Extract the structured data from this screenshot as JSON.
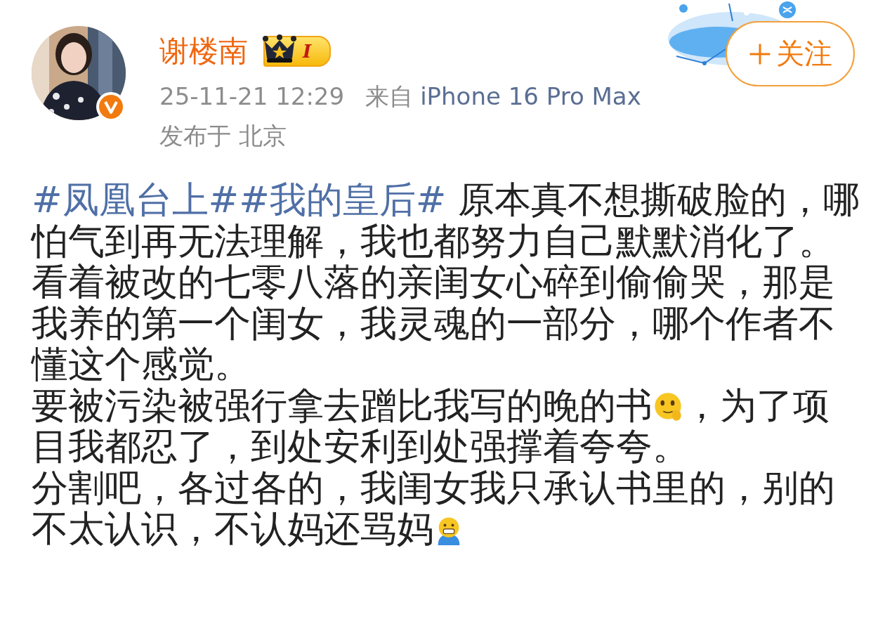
{
  "author": {
    "name": "谢楼南",
    "verified": true,
    "badge_level": "I"
  },
  "follow_button": {
    "label": "关注"
  },
  "meta": {
    "time": "25-11-21 12:29",
    "source_prefix": "来自",
    "source": "iPhone 16 Pro Max",
    "location": "发布于 北京"
  },
  "paragraphs": [
    [
      {
        "kind": "topic",
        "text": "#凤凰台上#"
      },
      {
        "kind": "topic",
        "text": "#我的皇后#"
      },
      {
        "kind": "text",
        "text": " 原本真不想撕破脸的，哪怕气到再无法理解，我也都努力自己默默消化了。看着被改的七零八落的亲闺女心碎到偷偷哭，那是我养的第一个闺女，我灵魂的一部分，哪个作者不懂这个感觉。"
      }
    ],
    [
      {
        "kind": "text",
        "text": "要被污染被强行拿去蹭比我写的晚的书"
      },
      {
        "kind": "smiley"
      },
      {
        "kind": "text",
        "text": "，为了项目我都忍了，到处安利到处强撑着夸夸。"
      }
    ],
    [
      {
        "kind": "text",
        "text": "分割吧，各过各的，我闺女我只承认书里的，别的不太认识，不认妈还骂妈"
      },
      {
        "kind": "grimace"
      }
    ]
  ]
}
